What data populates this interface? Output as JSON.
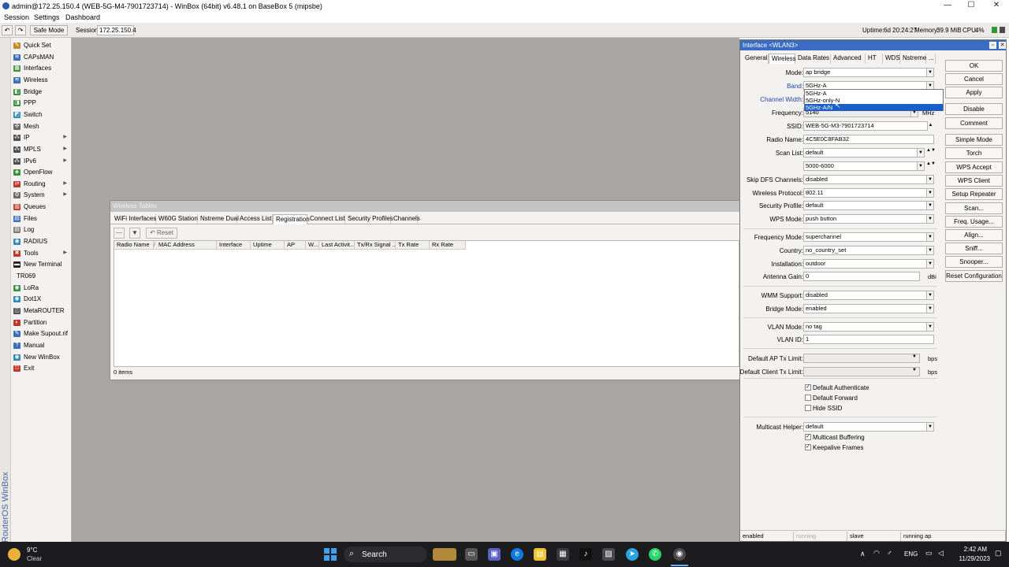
{
  "titlebar": {
    "title": "admin@172.25.150.4 (WEB-5G-M4-7901723714) - WinBox (64bit) v6.48.1 on BaseBox 5 (mipsbe)",
    "minimize": "—",
    "maximize": "☐",
    "close": "✕"
  },
  "menu": [
    "Session",
    "Settings",
    "Dashboard"
  ],
  "toolbar": {
    "undo": "↶",
    "redo": "↷",
    "safe_mode": "Safe Mode",
    "session_label": "Session:",
    "session_value": "172.25.150.4",
    "uptime_label": "Uptime:",
    "uptime_value": "6d 20:24:27",
    "memory_label": "Memory:",
    "memory_value": "39.9 MiB",
    "cpu_label": "CPU:",
    "cpu_value": "4%"
  },
  "vertical_brand": "RouterOS WinBox",
  "sidebar": [
    {
      "label": "Quick Set",
      "icon": "quick-set-icon",
      "glyph": "✎",
      "color": "#c68a2c",
      "arrow": false
    },
    {
      "label": "CAPsMAN",
      "icon": "capsman-icon",
      "glyph": "≋",
      "color": "#3b6fb7",
      "arrow": false
    },
    {
      "label": "Interfaces",
      "icon": "interfaces-icon",
      "glyph": "▦",
      "color": "#3c8f3c",
      "arrow": false
    },
    {
      "label": "Wireless",
      "icon": "wireless-icon",
      "glyph": "≋",
      "color": "#3b6fb7",
      "arrow": false
    },
    {
      "label": "Bridge",
      "icon": "bridge-icon",
      "glyph": "◧",
      "color": "#3c8f3c",
      "arrow": false
    },
    {
      "label": "PPP",
      "icon": "ppp-icon",
      "glyph": "◨",
      "color": "#3c8f3c",
      "arrow": false
    },
    {
      "label": "Switch",
      "icon": "switch-icon",
      "glyph": "◩",
      "color": "#2f8ab5",
      "arrow": false
    },
    {
      "label": "Mesh",
      "icon": "mesh-icon",
      "glyph": "✣",
      "color": "#6a6a6a",
      "arrow": false
    },
    {
      "label": "IP",
      "icon": "ip-icon",
      "glyph": "⁂",
      "color": "#4e4e4e",
      "arrow": true
    },
    {
      "label": "MPLS",
      "icon": "mpls-icon",
      "glyph": "⁂",
      "color": "#4e4e4e",
      "arrow": true
    },
    {
      "label": "IPv6",
      "icon": "ipv6-icon",
      "glyph": "⁂",
      "color": "#4e4e4e",
      "arrow": true
    },
    {
      "label": "OpenFlow",
      "icon": "openflow-icon",
      "glyph": "◈",
      "color": "#3c8f3c",
      "arrow": false
    },
    {
      "label": "Routing",
      "icon": "routing-icon",
      "glyph": "⇄",
      "color": "#c0392b",
      "arrow": true
    },
    {
      "label": "System",
      "icon": "system-icon",
      "glyph": "⚙",
      "color": "#6a6a6a",
      "arrow": true
    },
    {
      "label": "Queues",
      "icon": "queues-icon",
      "glyph": "▥",
      "color": "#c0392b",
      "arrow": false
    },
    {
      "label": "Files",
      "icon": "files-icon",
      "glyph": "▤",
      "color": "#3b6fb7",
      "arrow": false
    },
    {
      "label": "Log",
      "icon": "log-icon",
      "glyph": "▤",
      "color": "#7a7a7a",
      "arrow": false
    },
    {
      "label": "RADIUS",
      "icon": "radius-icon",
      "glyph": "◉",
      "color": "#2f8ab5",
      "arrow": false
    },
    {
      "label": "Tools",
      "icon": "tools-icon",
      "glyph": "✖",
      "color": "#c0392b",
      "arrow": true
    },
    {
      "label": "New Terminal",
      "icon": "terminal-icon",
      "glyph": "▬",
      "color": "#222222",
      "arrow": false
    },
    {
      "label": "TR069",
      "icon": "",
      "glyph": "",
      "color": "",
      "arrow": false
    },
    {
      "label": "LoRa",
      "icon": "lora-icon",
      "glyph": "◉",
      "color": "#3c8f3c",
      "arrow": false
    },
    {
      "label": "Dot1X",
      "icon": "dot1x-icon",
      "glyph": "◉",
      "color": "#2f8ab5",
      "arrow": false
    },
    {
      "label": "MetaROUTER",
      "icon": "metarouter-icon",
      "glyph": "◫",
      "color": "#4e4e4e",
      "arrow": false
    },
    {
      "label": "Partition",
      "icon": "partition-icon",
      "glyph": "◐",
      "color": "#c0392b",
      "arrow": false
    },
    {
      "label": "Make Supout.rif",
      "icon": "supout-icon",
      "glyph": "✎",
      "color": "#3b6fb7",
      "arrow": false
    },
    {
      "label": "Manual",
      "icon": "manual-icon",
      "glyph": "?",
      "color": "#3b6fb7",
      "arrow": false
    },
    {
      "label": "New WinBox",
      "icon": "winbox-icon",
      "glyph": "◉",
      "color": "#2f8ab5",
      "arrow": false
    },
    {
      "label": "Exit",
      "icon": "exit-icon",
      "glyph": "⎋",
      "color": "#c0392b",
      "arrow": false
    }
  ],
  "wireless_tables": {
    "title": "Wireless Tables",
    "tabs": [
      "WiFi Interfaces",
      "W60G Station",
      "Nstreme Dual",
      "Access List",
      "Registration",
      "Connect List",
      "Security Profiles",
      "Channels"
    ],
    "active_tab": "Registration",
    "tools": {
      "reset": "Reset"
    },
    "columns": [
      "Radio Name",
      "/",
      "MAC Address",
      "Interface",
      "Uptime",
      "AP",
      "W...",
      "Last Activit...",
      "Tx/Rx Signal ...",
      "Tx Rate",
      "Rx Rate"
    ],
    "status": "0 items"
  },
  "interface": {
    "title": "Interface <WLAN3>",
    "tabs": [
      "General",
      "Wireless",
      "Data Rates",
      "Advanced",
      "HT",
      "WDS",
      "Nstreme",
      "..."
    ],
    "active_tab": "Wireless",
    "fields": {
      "mode": {
        "label": "Mode:",
        "value": "ap bridge"
      },
      "band": {
        "label": "Band:",
        "value": "5GHz-A"
      },
      "channel_width": {
        "label": "Channel Width:",
        "value": ""
      },
      "frequency": {
        "label": "Frequency:",
        "value": "5140",
        "unit": "MHz"
      },
      "ssid": {
        "label": "SSID:",
        "value": "WEB-5G-M3-7901723714"
      },
      "radio_name": {
        "label": "Radio Name:",
        "value": "4C5E0C8FAB32"
      },
      "scan_list": {
        "label": "Scan List:",
        "value": "default",
        "value2": "5000-6000"
      },
      "skip_dfs": {
        "label": "Skip DFS Channels:",
        "value": "disabled"
      },
      "wireless_protocol": {
        "label": "Wireless Protocol:",
        "value": "802.11"
      },
      "security_profile": {
        "label": "Security Profile:",
        "value": "default"
      },
      "wps_mode": {
        "label": "WPS Mode:",
        "value": "push button"
      },
      "frequency_mode": {
        "label": "Frequency Mode:",
        "value": "superchannel"
      },
      "country": {
        "label": "Country:",
        "value": "no_country_set"
      },
      "installation": {
        "label": "Installation:",
        "value": "outdoor"
      },
      "antenna_gain": {
        "label": "Antenna Gain:",
        "value": "0",
        "unit": "dBi"
      },
      "wmm_support": {
        "label": "WMM Support:",
        "value": "disabled"
      },
      "bridge_mode": {
        "label": "Bridge Mode:",
        "value": "enabled"
      },
      "vlan_mode": {
        "label": "VLAN Mode:",
        "value": "no tag"
      },
      "vlan_id": {
        "label": "VLAN ID:",
        "value": "1"
      },
      "ap_tx_limit": {
        "label": "Default AP Tx Limit:",
        "value": "",
        "unit": "bps"
      },
      "client_tx_limit": {
        "label": "Default Client Tx Limit:",
        "value": "",
        "unit": "bps"
      },
      "multicast_helper": {
        "label": "Multicast Helper:",
        "value": "default"
      }
    },
    "checkboxes": [
      {
        "label": "Default Authenticate",
        "checked": true
      },
      {
        "label": "Default Forward",
        "checked": false
      },
      {
        "label": "Hide SSID",
        "checked": false
      },
      {
        "label": "Multicast Buffering",
        "checked": true
      },
      {
        "label": "Keepalive Frames",
        "checked": true
      }
    ],
    "band_options": [
      "5GHz-A",
      "5GHz-only-N",
      "5GHz-A/N"
    ],
    "band_selected": "5GHz-A/N",
    "buttons": [
      "OK",
      "Cancel",
      "Apply",
      "Disable",
      "Comment",
      "Simple Mode",
      "Torch",
      "WPS Accept",
      "WPS Client",
      "Setup Repeater",
      "Scan...",
      "Freq. Usage...",
      "Align...",
      "Sniff...",
      "Snooper...",
      "Reset Configuration"
    ],
    "status": [
      "enabled",
      "running",
      "slave",
      "running ap"
    ]
  },
  "taskbar": {
    "weather_temp": "9°C",
    "weather_desc": "Clear",
    "search": "Search",
    "lang": "ENG",
    "time": "2:42 AM",
    "date": "11/29/2023"
  }
}
